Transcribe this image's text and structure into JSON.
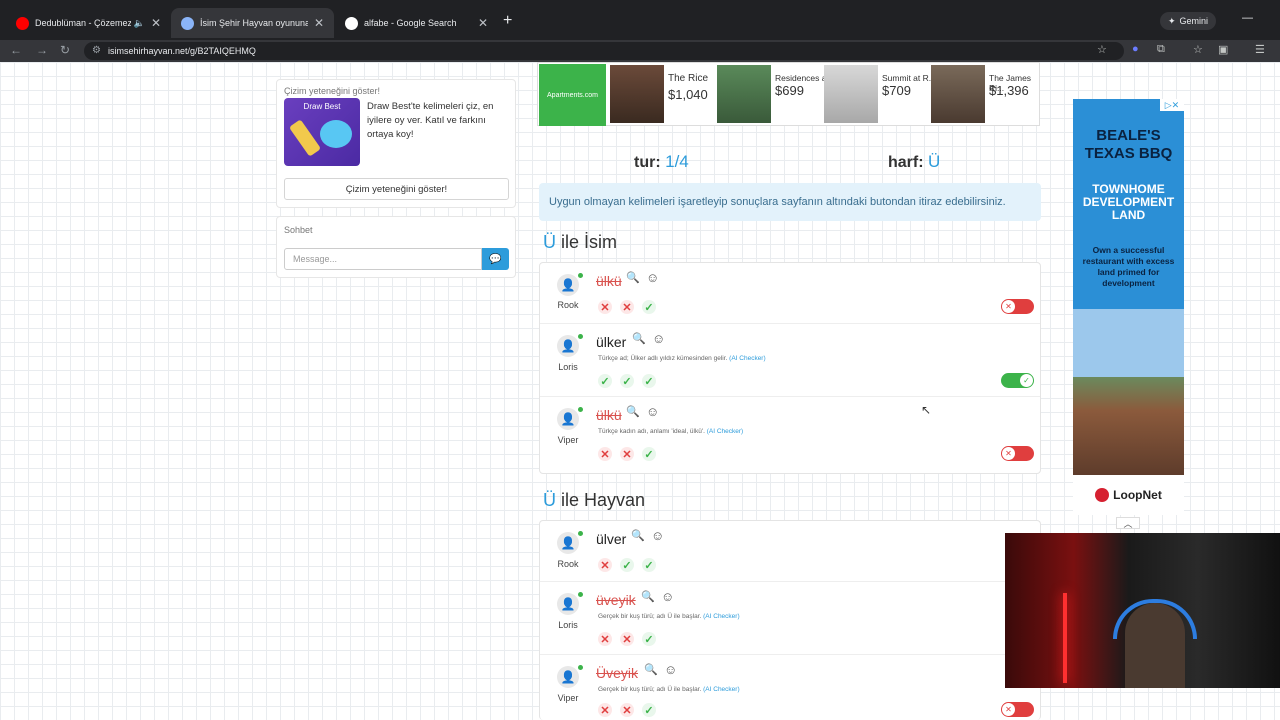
{
  "browser": {
    "tabs": [
      {
        "title": "Dedublüman - Çözemezsin",
        "favicon_color": "#ff0000",
        "active": false
      },
      {
        "title": "İsim Şehir Hayvan oyununa katıl",
        "favicon_color": "#8ab4f8",
        "active": true
      },
      {
        "title": "alfabe - Google Search",
        "favicon_color": "#ffffff",
        "active": false
      }
    ],
    "gemini_label": "Gemini",
    "url": "isimsehirhayvan.net/g/B2TAIQEHMQ"
  },
  "sidebar": {
    "draw_card": {
      "title": "Çizim yeteneğini göster!",
      "image_text": "Draw Best",
      "description": "Draw Best'te kelimeleri çiz, en iyilere oy ver. Katıl ve farkını ortaya koy!",
      "button_label": "Çizim yeteneğini göster!"
    },
    "chat": {
      "title": "Sohbet",
      "placeholder": "Message..."
    }
  },
  "ad_banner": {
    "logo": "Apartments.com",
    "listings": [
      {
        "name": "The Rice",
        "price": "$1,040"
      },
      {
        "name": "Residences a...",
        "price": "$699"
      },
      {
        "name": "Summit at R...",
        "price": "$709"
      },
      {
        "name": "The James Ri...",
        "price": "$1,396"
      }
    ]
  },
  "round": {
    "tur_label": "tur:",
    "tur_value": "1/4",
    "harf_label": "harf:",
    "harf_value": "Ü"
  },
  "info_text": "Uygun olmayan kelimeleri işaretleyip sonuçlara sayfanın altındaki butondan itiraz edebilirsiniz.",
  "sections": [
    {
      "letter": "Ü",
      "label": " ile İsim",
      "rows": [
        {
          "user": "Rook",
          "word": "ülkü",
          "rejected": true,
          "hint": "",
          "votes": [
            "no",
            "no",
            "yes"
          ],
          "toggle": "off"
        },
        {
          "user": "Loris",
          "word": "ülker",
          "rejected": false,
          "hint": "Türkçe ad; Ülker adlı yıldız kümesinden gelir.",
          "ai": "(AI Checker)",
          "votes": [
            "yes",
            "yes",
            "yes"
          ],
          "toggle": "on"
        },
        {
          "user": "Viper",
          "word": "ülkü",
          "rejected": true,
          "hint": "Türkçe kadın adı, anlamı 'ideal, ülkü'.",
          "ai": "(AI Checker)",
          "votes": [
            "no",
            "no",
            "yes"
          ],
          "toggle": "off"
        }
      ]
    },
    {
      "letter": "Ü",
      "label": " ile Hayvan",
      "rows": [
        {
          "user": "Rook",
          "word": "ülver",
          "rejected": false,
          "hint": "",
          "votes": [
            "no",
            "yes",
            "yes"
          ],
          "toggle": "on"
        },
        {
          "user": "Loris",
          "word": "üveyik",
          "rejected": true,
          "hint": "Gerçek bir kuş türü; adı Ü ile başlar.",
          "ai": "(AI Checker)",
          "votes": [
            "no",
            "no",
            "yes"
          ],
          "toggle": "off"
        },
        {
          "user": "Viper",
          "word": "Üveyik",
          "rejected": true,
          "hint": "Gerçek bir kuş türü; adı Ü ile başlar.",
          "ai": "(AI Checker)",
          "votes": [
            "no",
            "no",
            "yes"
          ],
          "toggle": "off"
        }
      ]
    }
  ],
  "side_ad": {
    "headline": "BEALE'S TEXAS BBQ",
    "subhead": "TOWNHOME DEVELOPMENT LAND",
    "body": "Own a successful restaurant with excess land primed for development",
    "brand": "LoopNet"
  },
  "icons": {
    "vote_no": "✕",
    "vote_yes": "✓",
    "search": "🔍",
    "emoji": "☺",
    "user": "👤"
  }
}
